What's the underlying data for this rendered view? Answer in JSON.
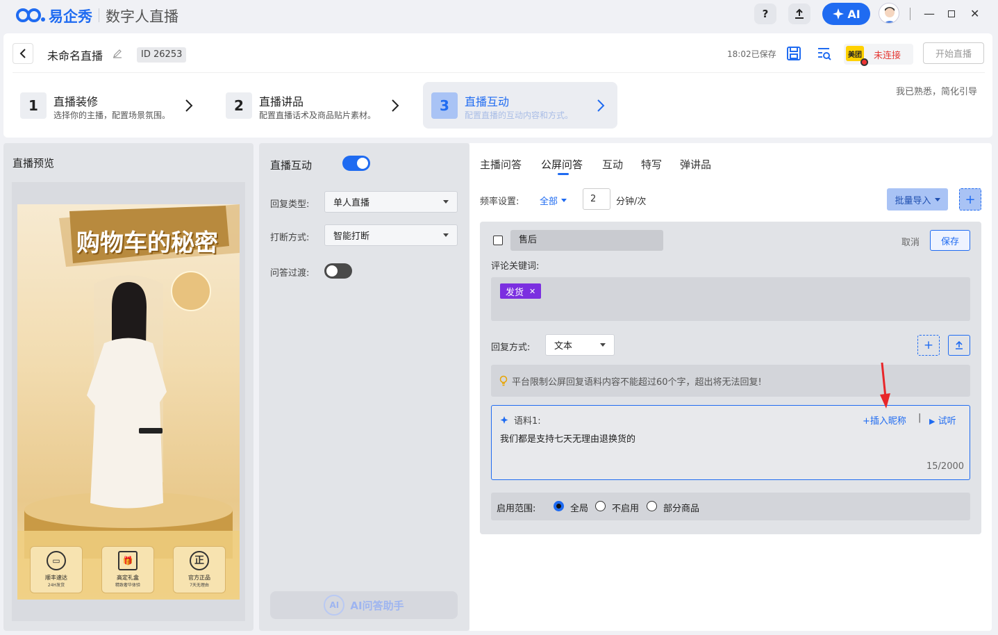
{
  "titlebar": {
    "logo_text": "易企秀",
    "app_name": "数字人直播",
    "help": "?",
    "ai_label": "AI"
  },
  "header": {
    "title": "未命名直播",
    "id_prefix": "ID",
    "id_value": "26253",
    "saved_text": "18:02已保存",
    "platform_logo": "美团",
    "platform_status": "未连接",
    "start_button": "开始直播",
    "skip_text": "我已熟悉，简化引导"
  },
  "steps": [
    {
      "num": "1",
      "title": "直播装修",
      "desc": "选择你的主播，配置场景氛围。"
    },
    {
      "num": "2",
      "title": "直播讲品",
      "desc": "配置直播话术及商品贴片素材。"
    },
    {
      "num": "3",
      "title": "直播互动",
      "desc": "配置直播的互动内容和方式。"
    }
  ],
  "preview": {
    "title": "直播预览",
    "banner": "购物车的秘密",
    "badges": [
      {
        "label": "顺丰速达",
        "sub": "24H发货"
      },
      {
        "label": "高定礼盒",
        "sub": "精致奢华体验"
      },
      {
        "label": "官方正品",
        "sub": "7天无理由"
      }
    ]
  },
  "interaction": {
    "title": "直播互动",
    "reply_type_label": "回复类型:",
    "reply_type_value": "单人直播",
    "interrupt_label": "打断方式:",
    "interrupt_value": "智能打断",
    "transition_label": "问答过渡:",
    "ai_assistant": "AI问答助手"
  },
  "tabs": [
    "主播问答",
    "公屏问答",
    "互动",
    "特写",
    "弹讲品"
  ],
  "frequency": {
    "label": "频率设置:",
    "all": "全部",
    "value": "2",
    "unit": "分钟/次",
    "batch_import": "批量导入"
  },
  "qa": {
    "name": "售后",
    "cancel": "取消",
    "save": "保存",
    "keyword_label": "评论关键词:",
    "keywords": [
      "发货"
    ],
    "reply_label": "回复方式:",
    "reply_value": "文本",
    "tip": "平台限制公屏回复语料内容不能超过60个字，超出将无法回复!",
    "corpus_label": "语料1:",
    "insert_nickname": "+插入昵称",
    "separator": "|",
    "try_listen": "试听",
    "corpus_text": "我们都是支持七天无理由退换货的",
    "counter": "15/2000",
    "scope_label": "启用范围:",
    "scope_options": [
      "全局",
      "不启用",
      "部分商品"
    ]
  },
  "colors": {
    "accent": "#1f6bf1",
    "tag": "#7b2fe0",
    "warning": "#e53935"
  }
}
